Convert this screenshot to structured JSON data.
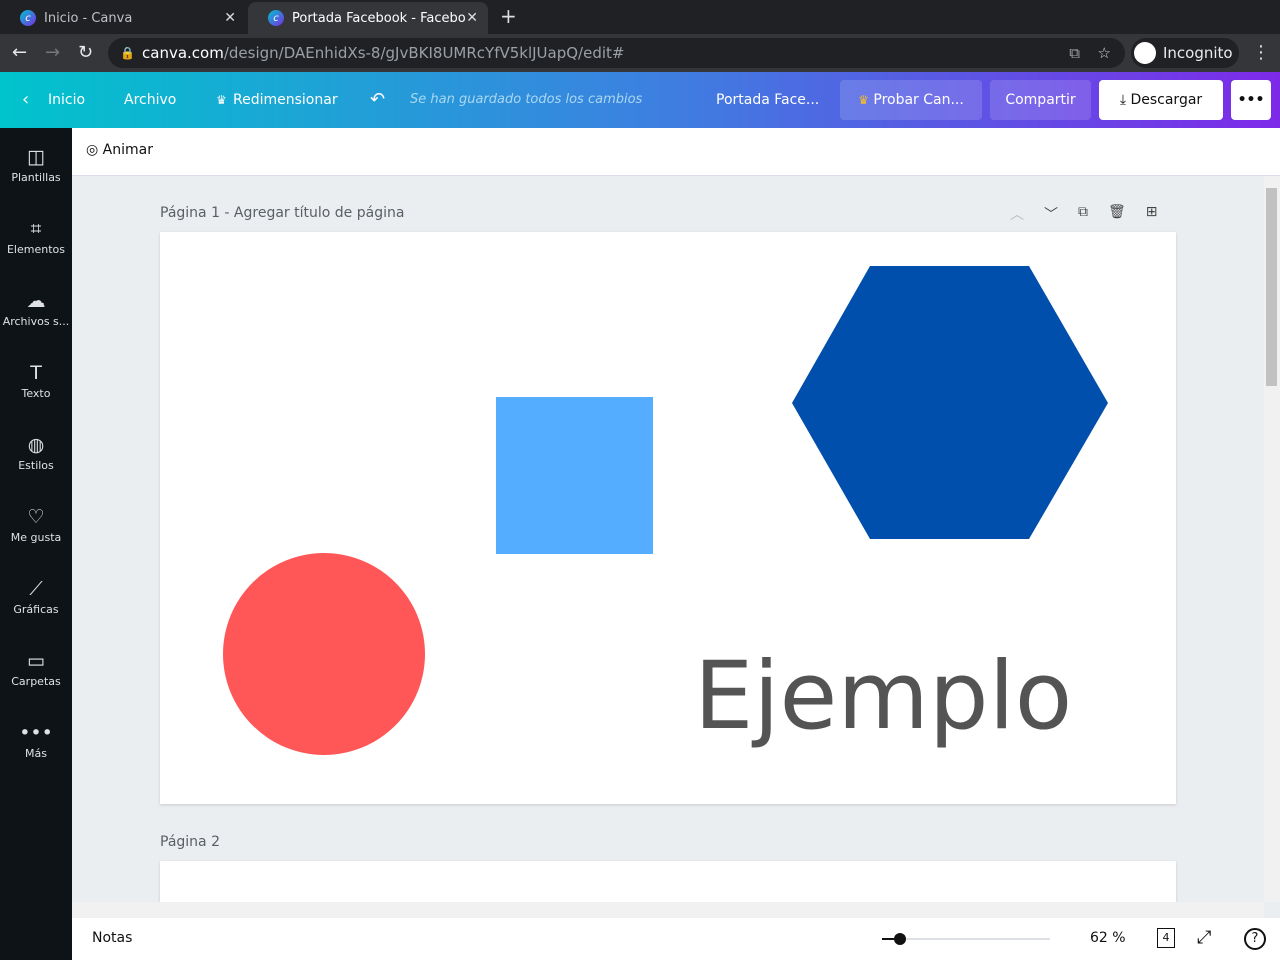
{
  "browser": {
    "tabs": [
      {
        "title": "Inicio - Canva"
      },
      {
        "title": "Portada Facebook - Facebo"
      }
    ],
    "url_host": "canva.com",
    "url_path": "/design/DAEnhidXs-8/gJvBKI8UMRcYfV5klJUapQ/edit#",
    "profile": "Incognito"
  },
  "toolbar": {
    "home": "Inicio",
    "file": "Archivo",
    "resize": "Redimensionar",
    "saved": "Se han guardado todos los cambios",
    "title": "Portada Face...",
    "try_pro": "Probar Can...",
    "share": "Compartir",
    "download": "Descargar"
  },
  "sidebar": {
    "items": [
      {
        "label": "Plantillas",
        "icon": "layout-icon"
      },
      {
        "label": "Elementos",
        "icon": "shapes-icon"
      },
      {
        "label": "Archivos s...",
        "icon": "upload-cloud-icon"
      },
      {
        "label": "Texto",
        "icon": "text-icon"
      },
      {
        "label": "Estilos",
        "icon": "palette-icon"
      },
      {
        "label": "Me gusta",
        "icon": "heart-icon"
      },
      {
        "label": "Gráficas",
        "icon": "chart-icon"
      },
      {
        "label": "Carpetas",
        "icon": "folder-icon"
      },
      {
        "label": "Más",
        "icon": "more-icon"
      }
    ]
  },
  "animate": "Animar",
  "pages": [
    {
      "label": "Página 1",
      "subtitle": " - Agregar título de página",
      "text": "Ejemplo"
    },
    {
      "label": "Página 2"
    }
  ],
  "colors": {
    "square": "#54adfe",
    "hexagon": "#004fac",
    "circle": "#ff5757",
    "text": "#545454"
  },
  "footer": {
    "notes": "Notas",
    "zoom": "62 %",
    "zoom_percent": 62,
    "page_count": "4"
  }
}
